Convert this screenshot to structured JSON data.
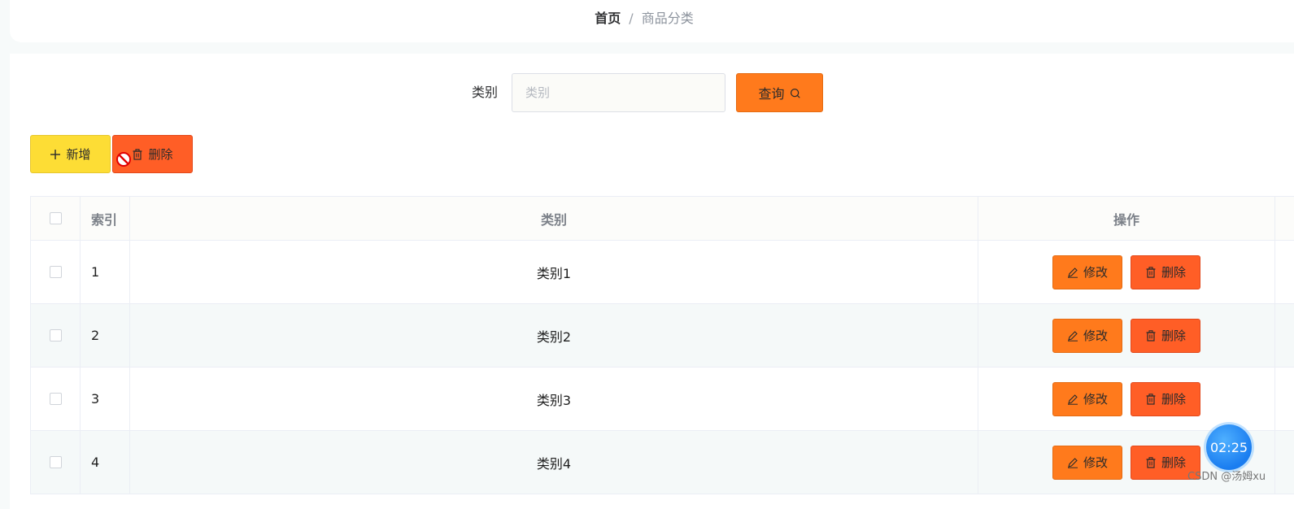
{
  "breadcrumb": {
    "home": "首页",
    "separator": "/",
    "current": "商品分类"
  },
  "search": {
    "label": "类别",
    "placeholder": "类别",
    "value": "",
    "button_label": "查询",
    "button_icon": "search-icon"
  },
  "toolbar": {
    "add_label": "新增",
    "add_icon": "plus-icon",
    "delete_label": "删除",
    "delete_icon": "trash-icon",
    "delete_disabled": true
  },
  "table": {
    "columns": [
      "索引",
      "类别",
      "操作"
    ],
    "rows": [
      {
        "index": "1",
        "category": "类别1",
        "edit_label": "修改",
        "delete_label": "删除"
      },
      {
        "index": "2",
        "category": "类别2",
        "edit_label": "修改",
        "delete_label": "删除"
      },
      {
        "index": "3",
        "category": "类别3",
        "edit_label": "修改",
        "delete_label": "删除"
      },
      {
        "index": "4",
        "category": "类别4",
        "edit_label": "修改",
        "delete_label": "删除"
      }
    ]
  },
  "timer": {
    "time": "02:25"
  },
  "watermark": "CSDN @汤姆xu",
  "colors": {
    "primary": "#ff7a1c",
    "danger": "#ff5e26",
    "warning": "#fddd35"
  }
}
